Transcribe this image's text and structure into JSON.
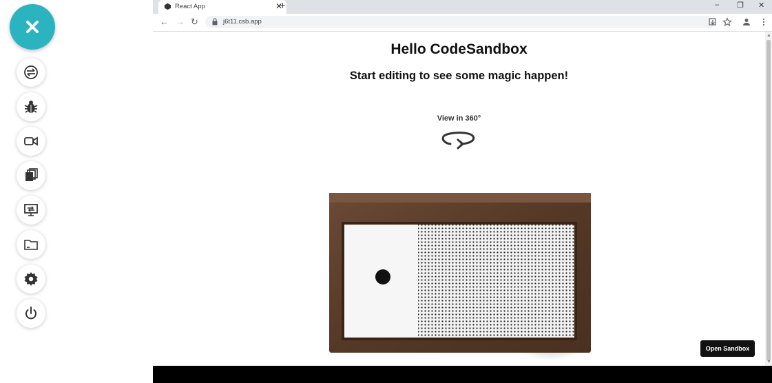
{
  "tools": {
    "close_icon": "close-icon",
    "items": [
      {
        "name": "sync-icon"
      },
      {
        "name": "bug-icon"
      },
      {
        "name": "video-camera-icon"
      },
      {
        "name": "copy-icon"
      },
      {
        "name": "remote-desktop-icon"
      },
      {
        "name": "folder-icon"
      },
      {
        "name": "gear-icon"
      },
      {
        "name": "power-icon"
      }
    ],
    "accent": "#2bb3c0"
  },
  "browser": {
    "tab": {
      "title": "React App",
      "close": "✕"
    },
    "new_tab": "+",
    "window_controls": {
      "minimize": "–",
      "restore": "❐",
      "close": "✕"
    },
    "nav": {
      "back": "←",
      "forward": "→",
      "reload": "↻"
    },
    "url": "j6t11.csb.app"
  },
  "page": {
    "heading": "Hello CodeSandbox",
    "subheading": "Start editing to see some magic happen!",
    "view360": "View in 360°",
    "open_sandbox": "Open Sandbox"
  }
}
